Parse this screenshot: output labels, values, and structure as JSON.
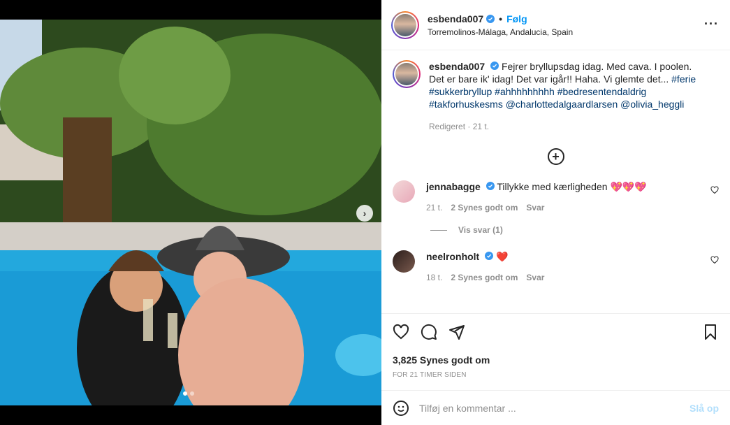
{
  "post": {
    "username": "esbenda007",
    "follow_label": "Følg",
    "location": "Torremolinos-Málaga, Andalucia, Spain",
    "separator": "•"
  },
  "caption": {
    "username": "esbenda007",
    "text": "Fejrer bryllupsdag idag. Med cava. I poolen. Det er bare ik' idag! Det var igår!! Haha. Vi glemte det...",
    "hashtags": "#ferie #sukkerbryllup #ahhhhhhhhh #bedresentendaldrig #takforhuskesms",
    "mentions": "@charlottedalgaardlarsen @olivia_heggli",
    "meta": "Redigeret · 21 t."
  },
  "comments": [
    {
      "username": "jennabagge",
      "text": "Tillykke med kærligheden",
      "emoji": "💖💖💖",
      "time": "21 t.",
      "likes": "2 Synes godt om",
      "reply": "Svar",
      "replies_label": "Vis svar (1)"
    },
    {
      "username": "neelronholt",
      "text": "",
      "emoji": "❤️",
      "time": "18 t.",
      "likes": "2 Synes godt om",
      "reply": "Svar"
    }
  ],
  "actions": {
    "likes_label": "3,825 Synes godt om",
    "timestamp": "FOR 21 TIMER SIDEN"
  },
  "add_comment": {
    "placeholder": "Tilføj en kommentar ...",
    "post_label": "Slå op"
  },
  "colors": {
    "accent": "#0095f6",
    "verified": "#3897f0",
    "heart": "#ed4956"
  }
}
